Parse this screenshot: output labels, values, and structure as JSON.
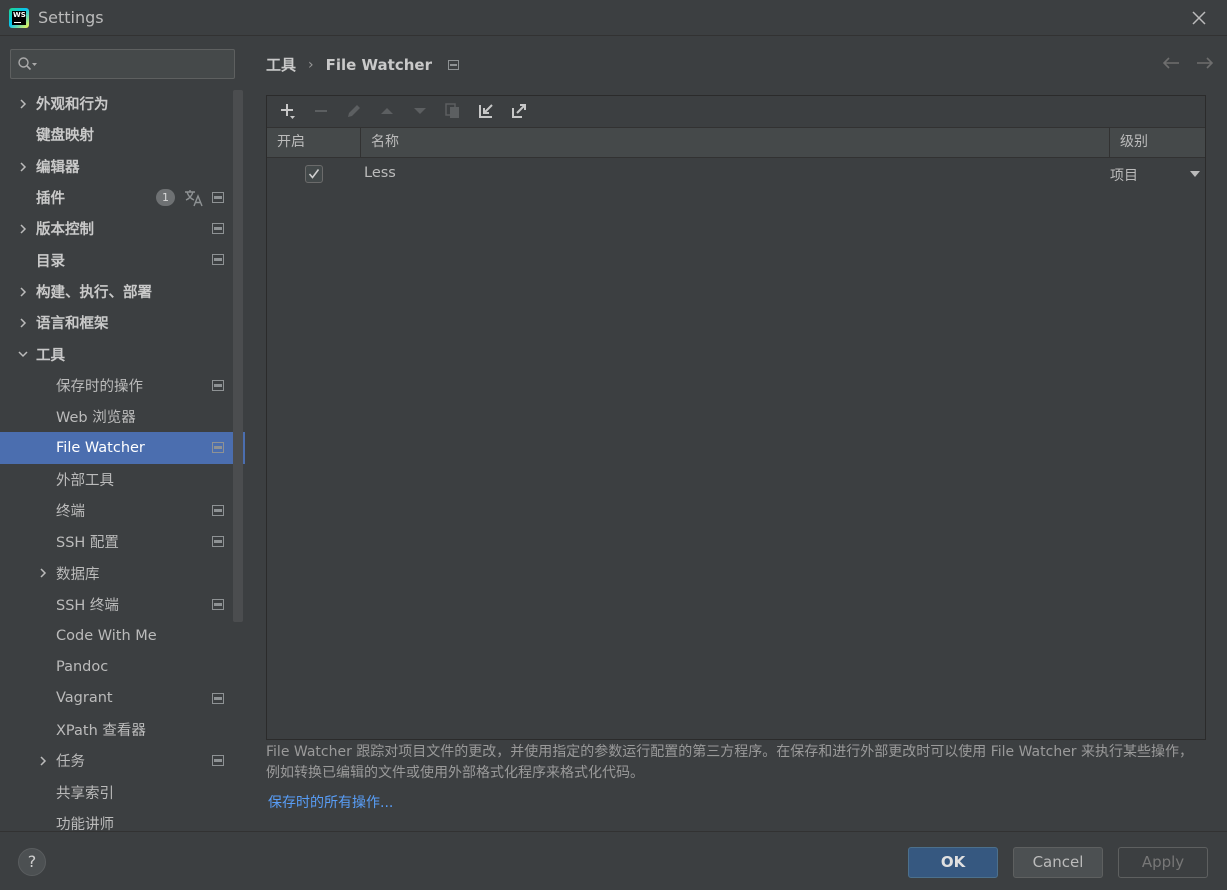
{
  "window": {
    "title": "Settings"
  },
  "search": {
    "placeholder": ""
  },
  "sidebar": {
    "items": [
      {
        "label": "外观和行为",
        "level": 0,
        "expandable": true,
        "expanded": false,
        "bold": true
      },
      {
        "label": "键盘映射",
        "level": 0,
        "expandable": false,
        "bold": true
      },
      {
        "label": "编辑器",
        "level": 0,
        "expandable": true,
        "expanded": false,
        "bold": true
      },
      {
        "label": "插件",
        "level": 0,
        "expandable": false,
        "bold": true,
        "badge": "1",
        "translate_icon": true,
        "project_icon": true
      },
      {
        "label": "版本控制",
        "level": 0,
        "expandable": true,
        "expanded": false,
        "bold": true,
        "project_icon": true
      },
      {
        "label": "目录",
        "level": 0,
        "expandable": false,
        "bold": true,
        "project_icon": true
      },
      {
        "label": "构建、执行、部署",
        "level": 0,
        "expandable": true,
        "expanded": false,
        "bold": true
      },
      {
        "label": "语言和框架",
        "level": 0,
        "expandable": true,
        "expanded": false,
        "bold": true
      },
      {
        "label": "工具",
        "level": 0,
        "expandable": true,
        "expanded": true,
        "bold": true
      },
      {
        "label": "保存时的操作",
        "level": 1,
        "expandable": false,
        "project_icon": true
      },
      {
        "label": "Web 浏览器",
        "level": 1,
        "expandable": false
      },
      {
        "label": "File Watcher",
        "level": 1,
        "expandable": false,
        "project_icon": true,
        "selected": true
      },
      {
        "label": "外部工具",
        "level": 1,
        "expandable": false
      },
      {
        "label": "终端",
        "level": 1,
        "expandable": false,
        "project_icon": true
      },
      {
        "label": "SSH 配置",
        "level": 1,
        "expandable": false,
        "project_icon": true
      },
      {
        "label": "数据库",
        "level": 1,
        "expandable": true,
        "expanded": false
      },
      {
        "label": "SSH 终端",
        "level": 1,
        "expandable": false,
        "project_icon": true
      },
      {
        "label": "Code With Me",
        "level": 1,
        "expandable": false
      },
      {
        "label": "Pandoc",
        "level": 1,
        "expandable": false
      },
      {
        "label": "Vagrant",
        "level": 1,
        "expandable": false,
        "project_icon": true
      },
      {
        "label": "XPath 查看器",
        "level": 1,
        "expandable": false
      },
      {
        "label": "任务",
        "level": 1,
        "expandable": true,
        "expanded": false,
        "project_icon": true
      },
      {
        "label": "共享索引",
        "level": 1,
        "expandable": false
      },
      {
        "label": "功能讲师",
        "level": 1,
        "expandable": false
      }
    ]
  },
  "breadcrumb": {
    "parent": "工具",
    "separator": "›",
    "current": "File Watcher"
  },
  "toolbar": {
    "icons": [
      "add-icon",
      "remove-icon",
      "edit-icon",
      "move-up-icon",
      "move-down-icon",
      "copy-icon",
      "import-icon",
      "export-icon"
    ]
  },
  "table": {
    "headers": {
      "enabled": "开启",
      "name": "名称",
      "level": "级别"
    },
    "rows": [
      {
        "enabled": true,
        "name": "Less",
        "level": "项目"
      }
    ]
  },
  "description": "File Watcher 跟踪对项目文件的更改，并使用指定的参数运行配置的第三方程序。在保存和进行外部更改时可以使用 File Watcher 来执行某些操作，例如转换已编辑的文件或使用外部格式化程序来格式化代码。",
  "link": "保存时的所有操作...",
  "footer": {
    "help_label": "?",
    "ok": "OK",
    "cancel": "Cancel",
    "apply": "Apply"
  },
  "colors": {
    "background": "#3c3f41",
    "selection": "#4b6eaf",
    "link": "#589df6",
    "ok_button": "#365880"
  }
}
